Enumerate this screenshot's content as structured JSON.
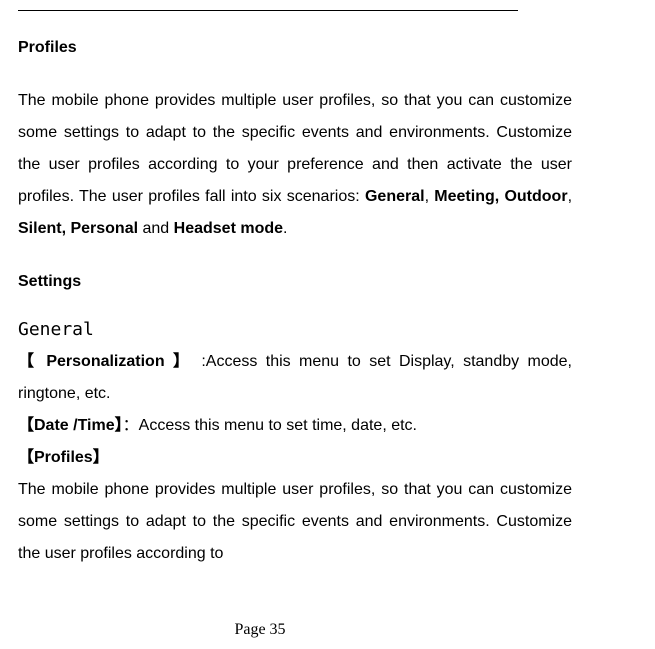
{
  "profiles": {
    "heading": "Profiles",
    "intro_before": "The mobile phone provides multiple user profiles, so that you can customize some settings to adapt to the specific events and environments. Customize the user profiles according to your preference and then activate the user profiles. The user profiles fall into six scenarios: ",
    "scenario1": "General",
    "comma_sep": ", ",
    "scenario2": "Meeting, Outdoor",
    "comma_sep2": ", ",
    "scenario3": "Silent, Personal",
    "and_word": " and ",
    "scenario4": "Headset mode",
    "period": "."
  },
  "settings": {
    "heading": "Settings",
    "general_heading": "General",
    "personalization": {
      "label": "【 Personalization 】",
      "text": " :Access  this  menu  to  set  Display, standby mode, ringtone, etc."
    },
    "datetime": {
      "label": "【Date /Time】",
      "colon": "：",
      "text": "Access this menu to set time, date, etc."
    },
    "profiles_sub": {
      "label": "【Profiles】"
    },
    "profiles_para": "The mobile phone provides multiple user profiles, so that you can customize some settings to adapt to the specific events and environments. Customize the user profiles according to"
  },
  "page_number": "Page 35"
}
